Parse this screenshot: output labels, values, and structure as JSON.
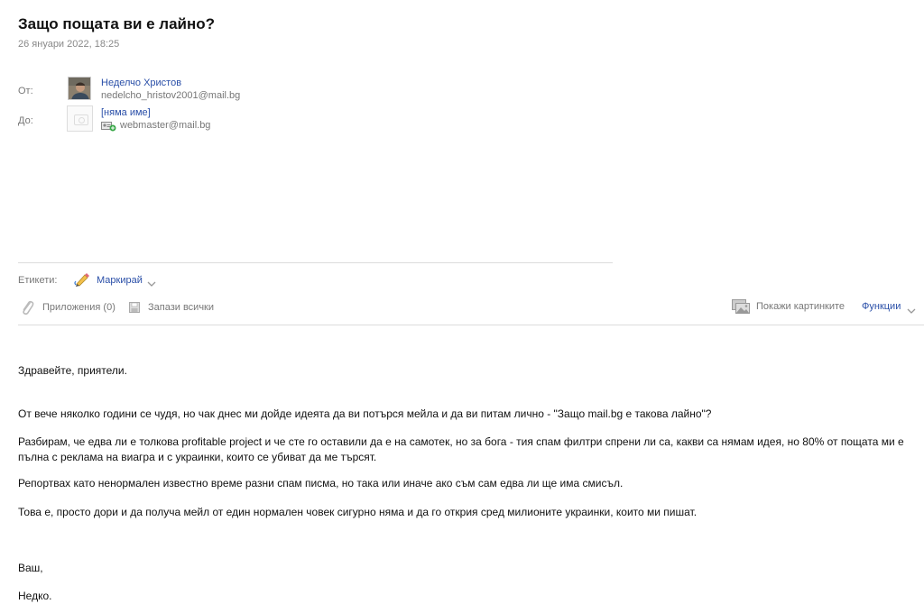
{
  "message": {
    "subject": "Защо пощата ви е лайно?",
    "date": "26 януари 2022, 18:25"
  },
  "header": {
    "from_label": "От:",
    "to_label": "До:",
    "from": {
      "name": "Неделчо Христов",
      "email": "nedelcho_hristov2001@mail.bg"
    },
    "to": {
      "name": "[няма име]",
      "email": "webmaster@mail.bg"
    }
  },
  "tags": {
    "label": "Етикети:",
    "mark_label": "Маркирай"
  },
  "toolbar": {
    "attachments_label": "Приложения (0)",
    "save_all_label": "Запази всички",
    "show_pictures_label": "Покажи картинките",
    "functions_label": "Функции"
  },
  "body": {
    "paragraphs": [
      "Здравейте, приятели.",
      "От вече няколко години се чудя, но чак днес ми дойде идеята да ви потърся мейла и да ви питам лично - \"Защо mail.bg е такова лайно\"?",
      "Разбирам, че едва ли е толкова profitable project и че сте го оставили да е на самотек, но за бога - тия спам филтри спрени ли са, какви са нямам идея, но 80% от пощата ми е пълна с реклама на виагра и с украинки, които се убиват да ме търсят.",
      "Репортвах като ненормален известно време разни спам писма, но така или иначе ако съм сам едва ли ще има смисъл.",
      "Това е, просто дори и да получа мейл от един нормален човек сигурно няма и да го открия сред милионите украинки, които ми пишат.",
      "Ваш,",
      "Недко."
    ]
  },
  "colors": {
    "link": "#2a4fa8",
    "muted": "#777777",
    "divider": "#dcdcdc"
  },
  "icons": [
    "person-avatar",
    "camera-placeholder-icon",
    "add-contact-icon",
    "pencil-tag-icon",
    "chevron-down-icon",
    "paperclip-icon",
    "save-disk-icon",
    "pictures-icon"
  ]
}
